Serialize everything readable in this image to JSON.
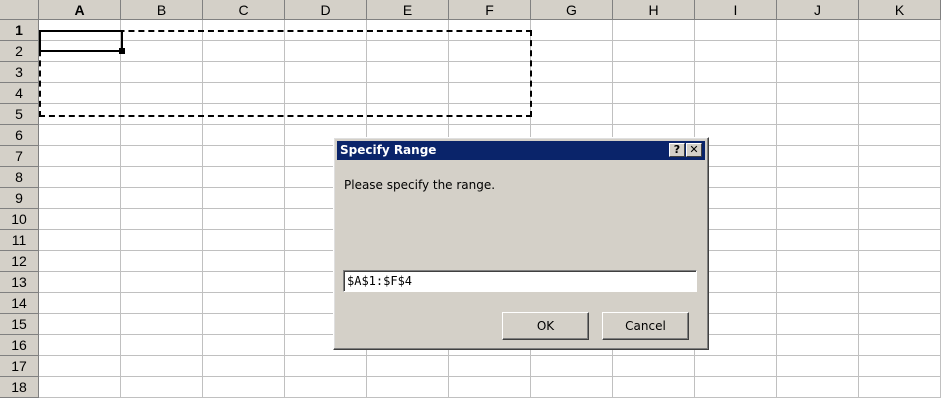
{
  "columns": [
    "A",
    "B",
    "C",
    "D",
    "E",
    "F",
    "G",
    "H",
    "I",
    "J",
    "K"
  ],
  "rows": [
    "1",
    "2",
    "3",
    "4",
    "5",
    "6",
    "7",
    "8",
    "9",
    "10",
    "11",
    "12",
    "13",
    "14",
    "15",
    "16",
    "17",
    "18"
  ],
  "active_cell": "A1",
  "dialog": {
    "title": "Specify Range",
    "help_label": "?",
    "close_label": "✕",
    "prompt": "Please specify the range.",
    "range_value": "$A$1:$F$4",
    "ok_label": "OK",
    "cancel_label": "Cancel"
  }
}
